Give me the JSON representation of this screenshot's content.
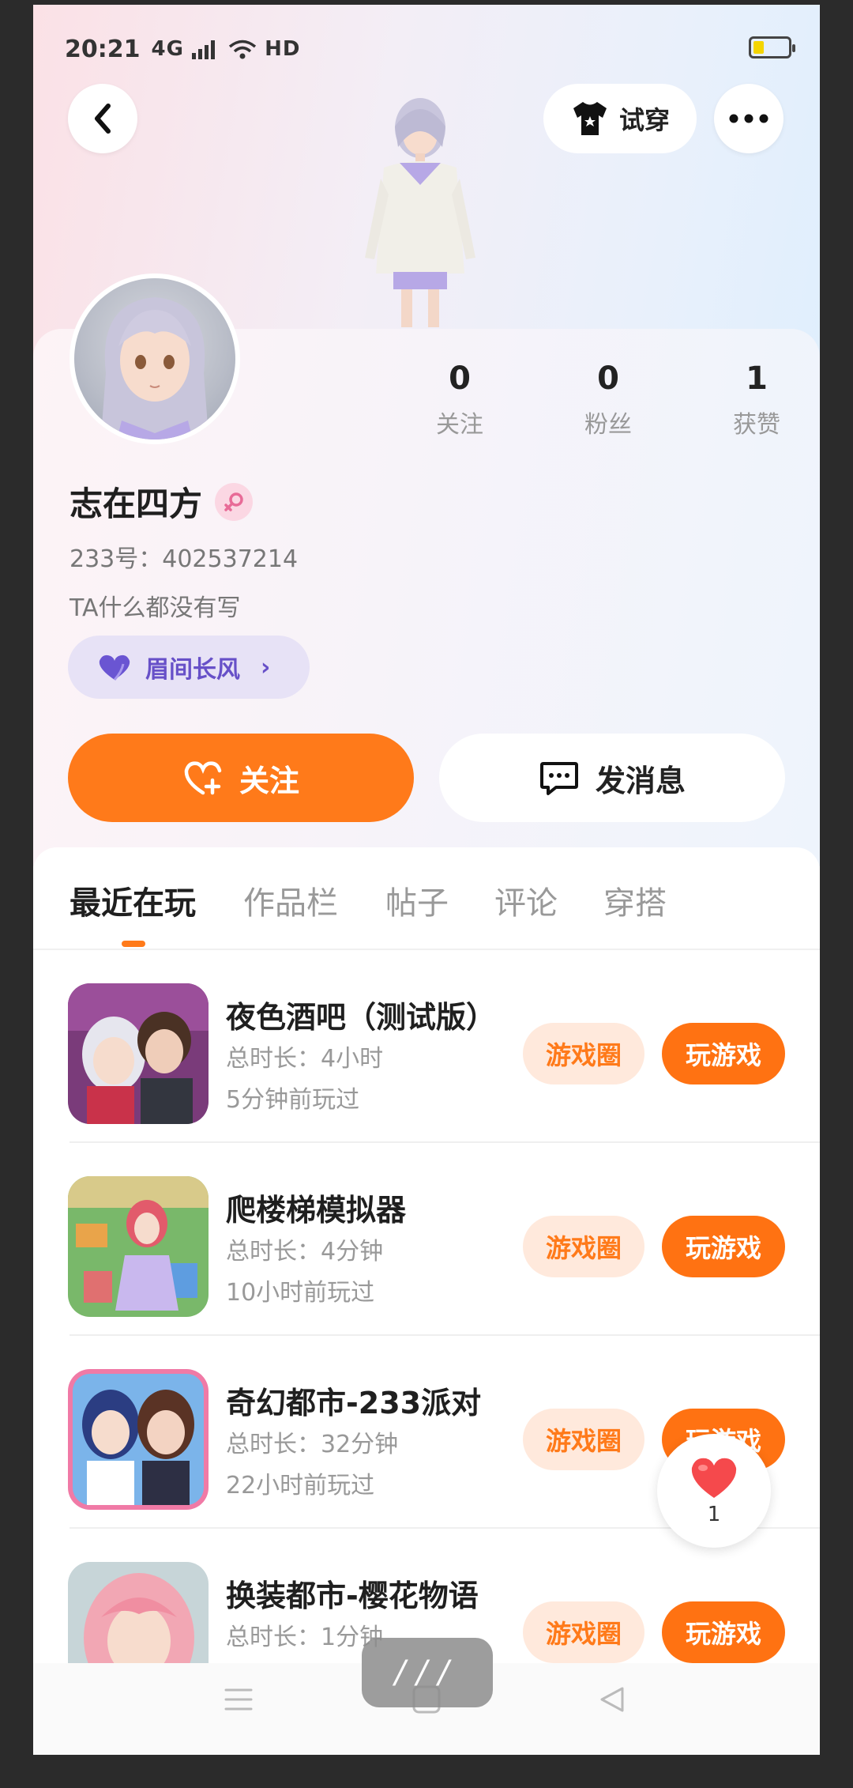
{
  "status_bar": {
    "time": "20:21",
    "signal": "4G",
    "network": "HD"
  },
  "header": {
    "tryon_label": "试穿"
  },
  "profile": {
    "stats": [
      {
        "value": "0",
        "label": "关注"
      },
      {
        "value": "0",
        "label": "粉丝"
      },
      {
        "value": "1",
        "label": "获赞"
      }
    ],
    "username": "志在四方",
    "uid": "233号：402537214",
    "bio": "TA什么都没有写",
    "tag_label": "眉间长风"
  },
  "actions": {
    "follow_label": "关注",
    "message_label": "发消息"
  },
  "tabs": [
    "最近在玩",
    "作品栏",
    "帖子",
    "评论",
    "穿搭"
  ],
  "games": [
    {
      "title": "夜色酒吧（测试版）",
      "duration": "总时长：4小时",
      "last_played": "5分钟前玩过",
      "circle_label": "游戏圈",
      "play_label": "玩游戏"
    },
    {
      "title": "爬楼梯模拟器",
      "duration": "总时长：4分钟",
      "last_played": "10小时前玩过",
      "circle_label": "游戏圈",
      "play_label": "玩游戏"
    },
    {
      "title": "奇幻都市-233派对",
      "duration": "总时长：32分钟",
      "last_played": "22小时前玩过",
      "circle_label": "游戏圈",
      "play_label": "玩游戏"
    },
    {
      "title": "换装都市-樱花物语",
      "duration": "总时长：1分钟",
      "last_played": "",
      "circle_label": "游戏圈",
      "play_label": "玩游戏"
    }
  ],
  "like_float": {
    "count": "1"
  },
  "colors": {
    "accent": "#ff7a1a",
    "tag": "#6750c8"
  }
}
